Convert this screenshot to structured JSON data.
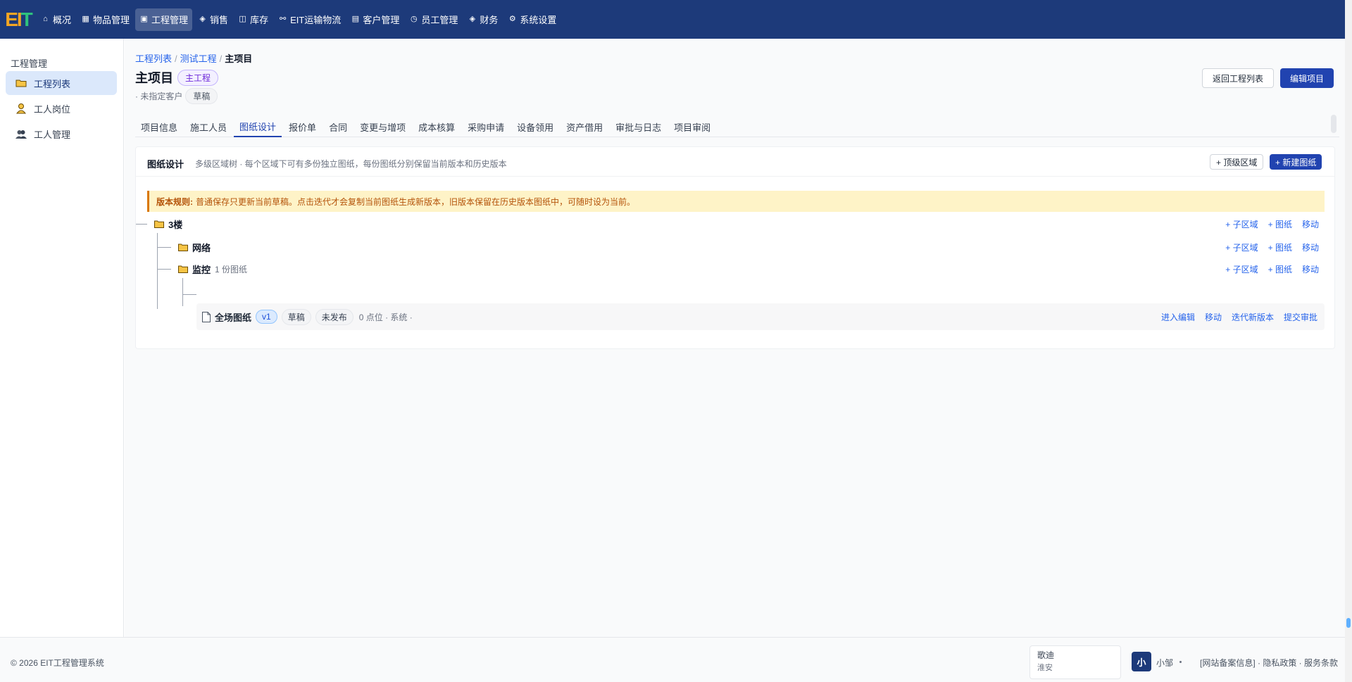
{
  "brand": {
    "logo_part1": "EI",
    "logo_part2": "T"
  },
  "nav": [
    {
      "label": "概况",
      "icon": "home-icon",
      "glyph": "⌂"
    },
    {
      "label": "物品管理",
      "icon": "grid-icon",
      "glyph": "▦"
    },
    {
      "label": "工程管理",
      "icon": "project-icon",
      "glyph": "▣",
      "active": true
    },
    {
      "label": "销售",
      "icon": "cube-icon",
      "glyph": "◈"
    },
    {
      "label": "库存",
      "icon": "box-icon",
      "glyph": "◫"
    },
    {
      "label": "EIT运输物流",
      "icon": "link-icon",
      "glyph": "⚯"
    },
    {
      "label": "客户管理",
      "icon": "image-icon",
      "glyph": "▤"
    },
    {
      "label": "员工管理",
      "icon": "clock-icon",
      "glyph": "◷"
    },
    {
      "label": "财务",
      "icon": "cube-icon",
      "glyph": "◈"
    },
    {
      "label": "系统设置",
      "icon": "settings-icon",
      "glyph": "⚙"
    }
  ],
  "sidebar": {
    "title": "工程管理",
    "items": [
      {
        "label": "工程列表",
        "icon": "folder-icon",
        "active": true
      },
      {
        "label": "工人岗位",
        "icon": "worker-icon"
      },
      {
        "label": "工人管理",
        "icon": "users-icon"
      }
    ]
  },
  "breadcrumb": [
    "工程列表",
    "测试工程",
    "主项目"
  ],
  "project": {
    "title": "主项目",
    "type_tag": "主工程",
    "customer": "· 未指定客户",
    "status_tag": "草稿",
    "back_button": "返回工程列表",
    "edit_button": "编辑项目"
  },
  "tabs": [
    "项目信息",
    "施工人员",
    "图纸设计",
    "报价单",
    "合同",
    "变更与增项",
    "成本核算",
    "采购申请",
    "设备领用",
    "资产借用",
    "审批与日志",
    "项目审阅"
  ],
  "active_tab": "图纸设计",
  "panel": {
    "title": "图纸设计",
    "desc": "多级区域树 · 每个区域下可有多份独立图纸，每份图纸分别保留当前版本和历史版本",
    "top_area_button": "+ 顶级区域",
    "new_drawing_button": "+ 新建图纸",
    "notice_label": "版本规则:",
    "notice_text": "普通保存只更新当前草稿。点击迭代才会复制当前图纸生成新版本，旧版本保留在历史版本图纸中，可随时设为当前。"
  },
  "tree": {
    "area_actions": [
      "+ 子区域",
      "+ 图纸",
      "移动"
    ],
    "root": {
      "name": "3楼"
    },
    "children": [
      {
        "name": "网络",
        "count": ""
      },
      {
        "name": "监控",
        "count": "1 份图纸"
      }
    ],
    "drawing": {
      "name": "全场图纸",
      "version": "v1",
      "status": "草稿",
      "publish": "未发布",
      "meta": "0 点位 · 系统 ·",
      "actions": [
        "进入编辑",
        "移动",
        "迭代新版本",
        "提交审批"
      ]
    }
  },
  "footer": {
    "copyright": "© 2026 EIT工程管理系统",
    "weather_title": "歌迪",
    "weather_sub": "淮安",
    "avatar": "小",
    "username": "小邹",
    "links": "[网站备案信息] · 隐私政策 · 服务条款"
  },
  "colors": {
    "nav_bg": "#1d3a7a",
    "primary": "#2143b0",
    "link": "#2563eb",
    "notice_bg": "#fef3c7",
    "notice_text": "#b45309"
  }
}
